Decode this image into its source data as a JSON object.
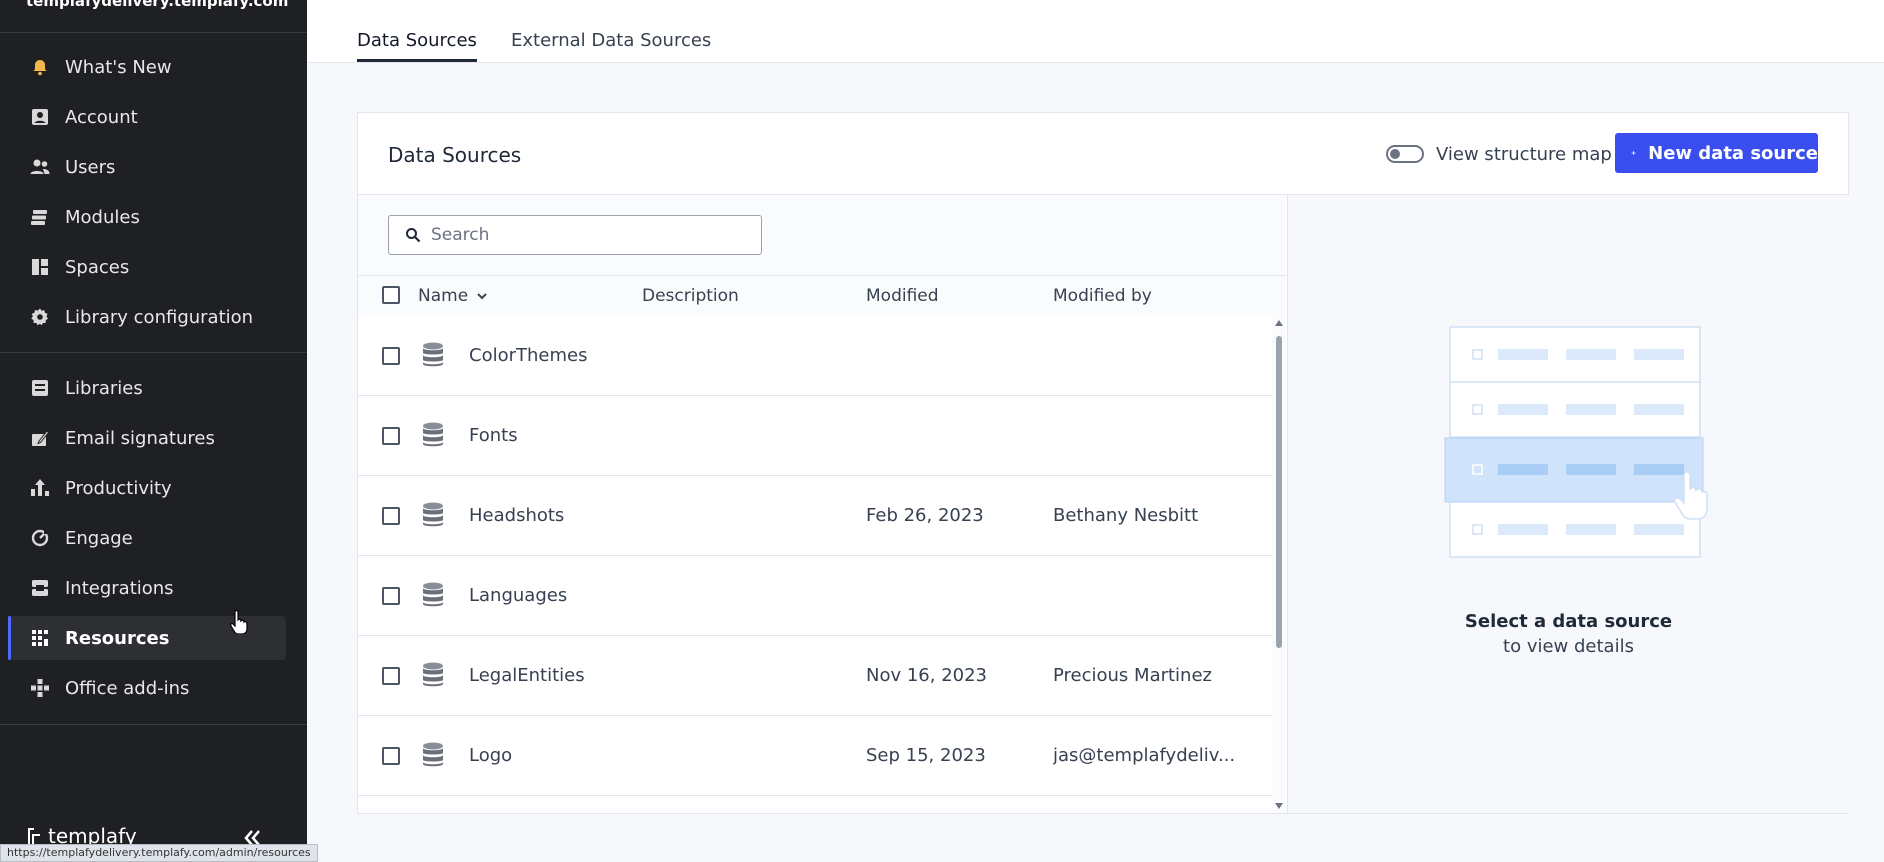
{
  "sidebar": {
    "tenant": "templafydelivery.templafy.com",
    "items": [
      {
        "label": "What's New"
      },
      {
        "label": "Account"
      },
      {
        "label": "Users"
      },
      {
        "label": "Modules"
      },
      {
        "label": "Spaces"
      },
      {
        "label": "Library configuration"
      },
      {
        "label": "Libraries"
      },
      {
        "label": "Email signatures"
      },
      {
        "label": "Productivity"
      },
      {
        "label": "Engage"
      },
      {
        "label": "Integrations"
      },
      {
        "label": "Resources"
      },
      {
        "label": "Office add-ins"
      }
    ],
    "active_item": "Resources",
    "brand": "templafy",
    "accent_color": "#4f6bff"
  },
  "statusbar": {
    "url": "https://templafydelivery.templafy.com/admin/resources"
  },
  "tabs": [
    {
      "label": "Data Sources",
      "active": true
    },
    {
      "label": "External Data Sources",
      "active": false
    }
  ],
  "card": {
    "title": "Data Sources",
    "toggle_label": "View structure map",
    "toggle_on": false,
    "new_button_label": "New data source",
    "button_color": "#3a4ef0"
  },
  "search": {
    "placeholder": "Search",
    "value": ""
  },
  "table": {
    "columns": [
      "Name",
      "Description",
      "Modified",
      "Modified by"
    ],
    "sort_column": "Name",
    "rows": [
      {
        "name": "ColorThemes",
        "description": "",
        "modified": "",
        "modified_by": ""
      },
      {
        "name": "Fonts",
        "description": "",
        "modified": "",
        "modified_by": ""
      },
      {
        "name": "Headshots",
        "description": "",
        "modified": "Feb 26, 2023",
        "modified_by": "Bethany Nesbitt"
      },
      {
        "name": "Languages",
        "description": "",
        "modified": "",
        "modified_by": ""
      },
      {
        "name": "LegalEntities",
        "description": "",
        "modified": "Nov 16, 2023",
        "modified_by": "Precious Martinez"
      },
      {
        "name": "Logo",
        "description": "",
        "modified": "Sep 15, 2023",
        "modified_by": "jas@templafydeliv..."
      }
    ]
  },
  "detail": {
    "empty_title": "Select a data source",
    "empty_subtitle": "to view details"
  }
}
